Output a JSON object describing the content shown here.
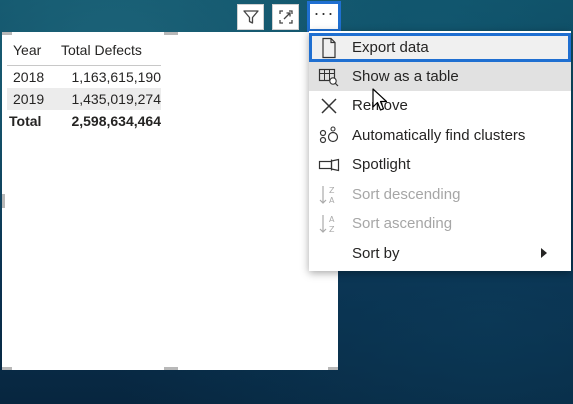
{
  "table": {
    "headers": {
      "year": "Year",
      "total_defects": "Total Defects"
    },
    "rows": [
      {
        "year": "2018",
        "total_defects": "1,163,615,190"
      },
      {
        "year": "2019",
        "total_defects": "1,435,019,274"
      }
    ],
    "total": {
      "label": "Total",
      "value": "2,598,634,464"
    }
  },
  "header_icons": [
    "filter-icon",
    "focus-mode-icon",
    "more-options-icon"
  ],
  "more_options_label": "···",
  "menu": {
    "items": [
      {
        "label": "Export data",
        "icon": "export-icon",
        "state": "selected"
      },
      {
        "label": "Show as a table",
        "icon": "table-icon",
        "state": "hover"
      },
      {
        "label": "Remove",
        "icon": "close-icon",
        "state": "normal"
      },
      {
        "label": "Automatically find clusters",
        "icon": "clusters-icon",
        "state": "normal"
      },
      {
        "label": "Spotlight",
        "icon": "spotlight-icon",
        "state": "normal"
      },
      {
        "label": "Sort descending",
        "icon": "sort-descending-icon",
        "state": "disabled"
      },
      {
        "label": "Sort ascending",
        "icon": "sort-ascending-icon",
        "state": "disabled"
      },
      {
        "label": "Sort by",
        "icon": "",
        "state": "normal",
        "has_submenu": true
      }
    ]
  },
  "colors": {
    "highlight_border": "#1f6fd1",
    "hover_bg": "#e1e1e1",
    "disabled_text": "#a6a6a6"
  }
}
